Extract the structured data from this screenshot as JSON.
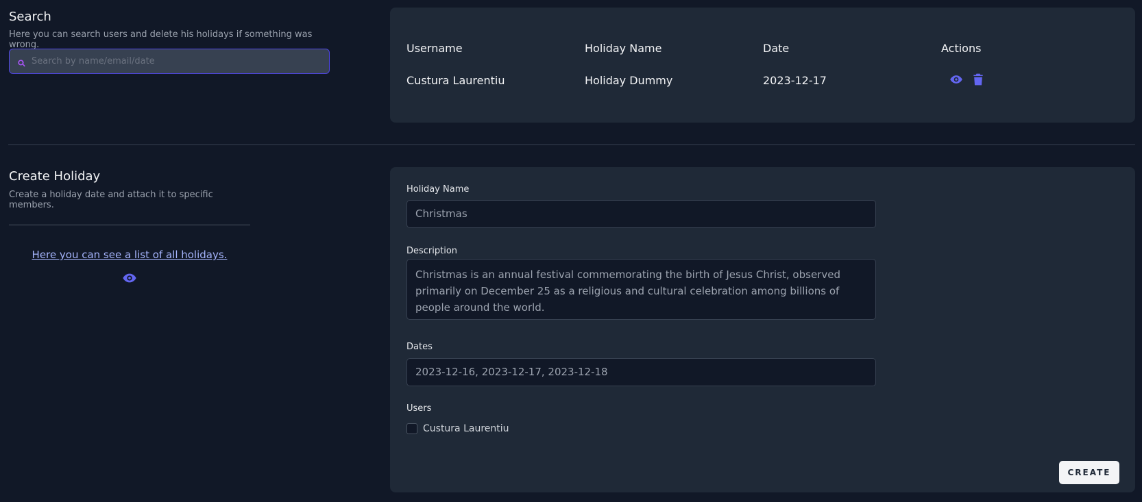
{
  "search": {
    "title": "Search",
    "subtitle": "Here you can search users and delete his holidays if something was wrong.",
    "placeholder": "Search by name/email/date",
    "value": ""
  },
  "results": {
    "columns": [
      "Username",
      "Holiday Name",
      "Date",
      "Actions"
    ],
    "rows": [
      {
        "username": "Custura Laurentiu",
        "holiday_name": "Holiday Dummy",
        "date": "2023-12-17"
      }
    ]
  },
  "create": {
    "title": "Create Holiday",
    "subtitle": "Create a holiday date and attach it to specific members.",
    "list_link": "Here you can see a list of all holidays.",
    "form": {
      "name_label": "Holiday Name",
      "name_placeholder": "Christmas",
      "description_label": "Description",
      "description_placeholder": "Christmas is an annual festival commemorating the birth of Jesus Christ, observed primarily on December 25 as a religious and cultural celebration among billions of people around the world.",
      "dates_label": "Dates",
      "dates_placeholder": "2023-12-16, 2023-12-17, 2023-12-18",
      "users_label": "Users",
      "users": [
        {
          "name": "Custura Laurentiu",
          "checked": false
        }
      ],
      "submit_label": "CREATE"
    }
  },
  "colors": {
    "background": "#111827",
    "card": "#1f2937",
    "accent": "#6366f1",
    "focus_border": "#4f46e5"
  },
  "icons": {
    "search": "search-icon",
    "view": "eye-icon",
    "delete": "trash-icon"
  }
}
